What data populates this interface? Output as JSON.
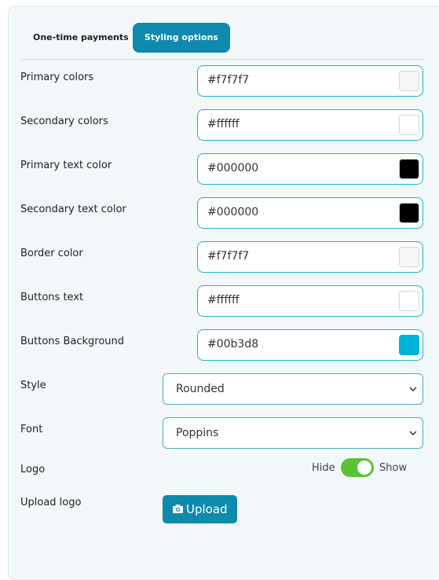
{
  "tabs": [
    {
      "label": "One-time payments",
      "active": false
    },
    {
      "label": "Styling options",
      "active": true
    }
  ],
  "colors": [
    {
      "label": "Primary colors",
      "value": "#f7f7f7"
    },
    {
      "label": "Secondary colors",
      "value": "#ffffff"
    },
    {
      "label": "Primary text color",
      "value": "#000000"
    },
    {
      "label": "Secondary text color",
      "value": "#000000"
    },
    {
      "label": "Border color",
      "value": "#f7f7f7"
    },
    {
      "label": "Buttons text",
      "value": "#ffffff"
    },
    {
      "label": "Buttons Background",
      "value": "#00b3d8"
    }
  ],
  "style": {
    "label": "Style",
    "value": "Rounded"
  },
  "font": {
    "label": "Font",
    "value": "Poppins"
  },
  "logo": {
    "label": "Logo",
    "hide_label": "Hide",
    "show_label": "Show",
    "state": "Show"
  },
  "upload": {
    "label": "Upload logo",
    "button_label": "Upload"
  },
  "theme": {
    "accent": "#0e8aad",
    "input_border": "#1fb3d1",
    "toggle_on": "#5bc236"
  }
}
